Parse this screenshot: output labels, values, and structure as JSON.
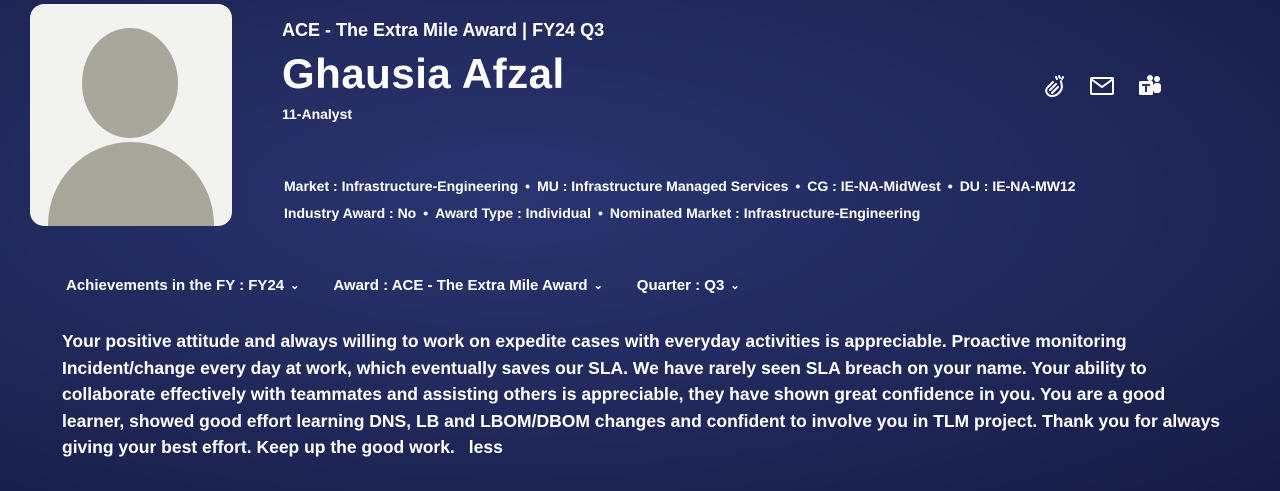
{
  "header": {
    "award_title": "ACE - The Extra Mile Award | FY24 Q3",
    "name": "Ghausia Afzal",
    "role": "11-Analyst"
  },
  "actions": [
    {
      "icon": "clap-icon"
    },
    {
      "icon": "mail-icon"
    },
    {
      "icon": "teams-icon"
    }
  ],
  "meta": {
    "line1": [
      "Market : Infrastructure-Engineering",
      "MU : Infrastructure Managed Services",
      "CG : IE-NA-MidWest",
      "DU : IE-NA-MW12"
    ],
    "line2": [
      "Industry Award : No",
      "Award Type : Individual",
      "Nominated Market : Infrastructure-Engineering"
    ],
    "separator": "•"
  },
  "filters": [
    {
      "label": "Achievements in the FY : FY24"
    },
    {
      "label": "Award : ACE - The Extra Mile Award"
    },
    {
      "label": "Quarter : Q3"
    }
  ],
  "description": {
    "text": "Your positive attitude and always willing to work on expedite cases with everyday activities is appreciable. Proactive monitoring Incident/change every day at work, which eventually saves our SLA. We have rarely seen SLA breach on your name. Your ability to collaborate effectively with teammates and assisting others is appreciable, they have shown great confidence in you. You are a good learner, showed good effort learning DNS, LB and LBOM/DBOM changes and confident to involve you in TLM project. Thank you for always giving your best effort. Keep up the good work.",
    "less_label": "less"
  }
}
